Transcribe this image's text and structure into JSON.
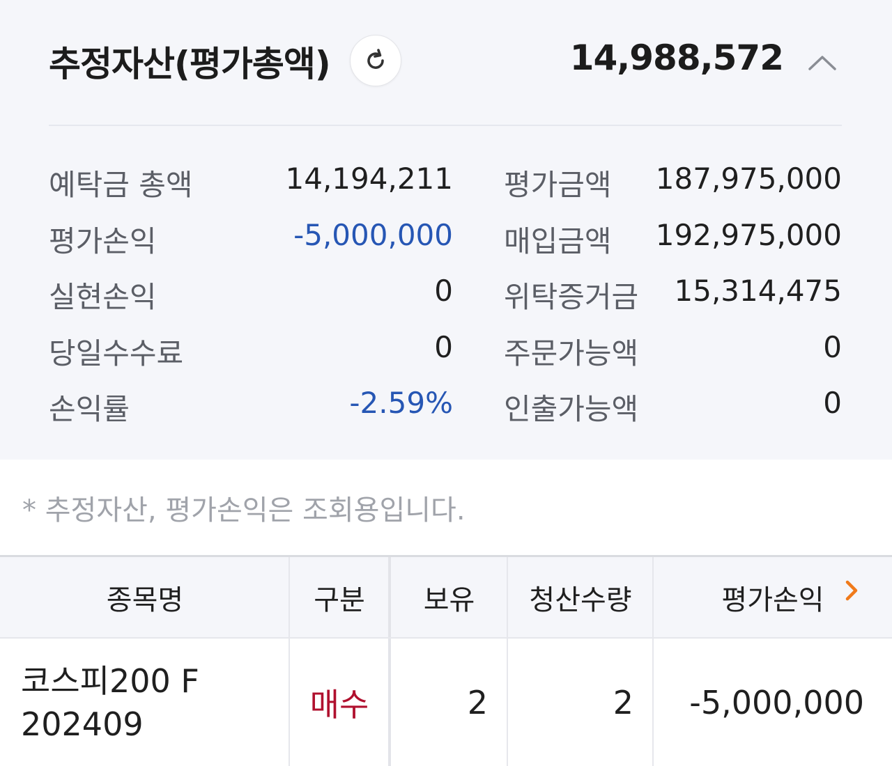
{
  "summary": {
    "title": "추정자산(평가총액)",
    "total": "14,988,572",
    "rows": [
      {
        "left_label": "예탁금 총액",
        "left_value": "14,194,211",
        "right_label": "평가금액",
        "right_value": "187,975,000"
      },
      {
        "left_label": "평가손익",
        "left_value": "-5,000,000",
        "right_label": "매입금액",
        "right_value": "192,975,000"
      },
      {
        "left_label": "실현손익",
        "left_value": "0",
        "right_label": "위탁증거금",
        "right_value": "15,314,475"
      },
      {
        "left_label": "당일수수료",
        "left_value": "0",
        "right_label": "주문가능액",
        "right_value": "0"
      },
      {
        "left_label": "손익률",
        "left_value": "-2.59%",
        "right_label": "인출가능액",
        "right_value": "0"
      }
    ],
    "icons": {
      "refresh": "refresh-icon",
      "collapse": "chevron-up-icon"
    },
    "colors": {
      "negative": "#2656b4",
      "background": "#f5f6fa"
    }
  },
  "note": "* 추정자산, 평가손익은 조회용입니다.",
  "table": {
    "headers": [
      "종목명",
      "구분",
      "보유",
      "청산수량",
      "평가손익"
    ],
    "rows": [
      {
        "name_line1": "코스피200 F",
        "name_line2": "202409",
        "type": "매수",
        "holding": "2",
        "liquidation_qty": "2",
        "pnl": "-5,000,000"
      }
    ],
    "colors": {
      "buy": "#b0102e",
      "negative": "#2656b4",
      "arrow": "#f07a1a"
    }
  }
}
